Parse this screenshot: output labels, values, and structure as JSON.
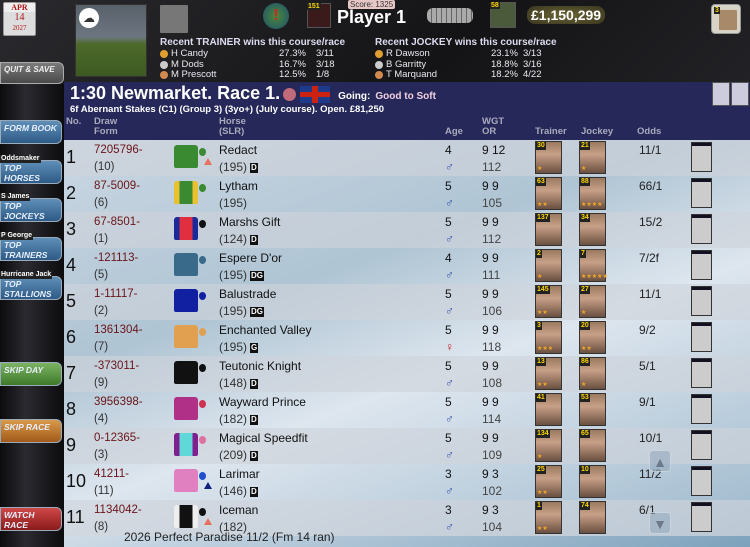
{
  "date": {
    "month": "APR",
    "day": "14",
    "year": "2027"
  },
  "top": {
    "score": "Score: 1325",
    "player": "Player 1",
    "money": "£1,150,299",
    "silhouette_count": "151",
    "stable_count": "58",
    "book_count": "3"
  },
  "recent_trainer": {
    "header": "Recent TRAINER wins this course/race",
    "rows": [
      {
        "name": "H Candy",
        "pct": "27.3%",
        "ratio": "3/11"
      },
      {
        "name": "M Dods",
        "pct": "16.7%",
        "ratio": "3/18"
      },
      {
        "name": "M Prescott",
        "pct": "12.5%",
        "ratio": "1/8"
      }
    ]
  },
  "recent_jockey": {
    "header": "Recent JOCKEY wins this course/race",
    "rows": [
      {
        "name": "R Dawson",
        "pct": "23.1%",
        "ratio": "3/13"
      },
      {
        "name": "B Garritty",
        "pct": "18.8%",
        "ratio": "3/16"
      },
      {
        "name": "T Marquand",
        "pct": "18.2%",
        "ratio": "4/22"
      }
    ]
  },
  "left": {
    "quit": "QUIT & SAVE",
    "form_book": "FORM BOOK",
    "top_horses_tag": "Oddsmaker",
    "top_horses": "TOP HORSES",
    "top_jockeys_tag": "S James",
    "top_jockeys": "TOP JOCKEYS",
    "top_trainers_tag": "P George",
    "top_trainers": "TOP TRAINERS",
    "top_stallions_tag": "Hurricane Jack",
    "top_stallions": "TOP STALLIONS",
    "skip_day": "SKIP DAY",
    "skip_race": "SKIP RACE",
    "watch_race": "WATCH RACE"
  },
  "race": {
    "title": "1:30 Newmarket. Race 1.",
    "going_label": "Going:",
    "going": "Good to Soft",
    "subtitle": "6f Abernant Stakes (C1) (Group 3) (3yo+) (July course). Open. £81,250"
  },
  "columns": {
    "no": "No.",
    "draw": "Draw",
    "form": "Form",
    "horse": "Horse",
    "slr": "(SLR)",
    "age": "Age",
    "wgt": "WGT",
    "or": "OR",
    "trainer": "Trainer",
    "jockey": "Jockey",
    "odds": "Odds"
  },
  "runners": [
    {
      "no": "1",
      "form": "7205796-",
      "draw": "(10)",
      "name": "Redact",
      "slr": "(195)",
      "badge": "D",
      "age": "4",
      "sex": "♂",
      "wgt": "9 12",
      "or": "112",
      "trainer_num": "30",
      "trainer_stars": "★",
      "jockey_num": "21",
      "jockey_stars": "★",
      "odds": "11/1"
    },
    {
      "no": "2",
      "form": "87-5009-",
      "draw": "(6)",
      "name": "Lytham",
      "slr": "(195)",
      "badge": "",
      "age": "5",
      "sex": "♂",
      "wgt": "9 9",
      "or": "105",
      "trainer_num": "63",
      "trainer_stars": "★★",
      "jockey_num": "88",
      "jockey_stars": "★★★★",
      "odds": "66/1"
    },
    {
      "no": "3",
      "form": "67-8501-",
      "draw": "(1)",
      "name": "Marshs Gift",
      "slr": "(124)",
      "badge": "D",
      "age": "5",
      "sex": "♂",
      "wgt": "9 9",
      "or": "112",
      "trainer_num": "137",
      "trainer_stars": "",
      "jockey_num": "34",
      "jockey_stars": "",
      "odds": "15/2"
    },
    {
      "no": "4",
      "form": "-121113-",
      "draw": "(5)",
      "name": "Espere D'or",
      "slr": "(195)",
      "badge": "DG",
      "age": "4",
      "sex": "♂",
      "wgt": "9 9",
      "or": "111",
      "trainer_num": "2",
      "trainer_stars": "★",
      "jockey_num": "7",
      "jockey_stars": "★★★★★",
      "odds": "7/2f"
    },
    {
      "no": "5",
      "form": "1-11117-",
      "draw": "(2)",
      "name": "Balustrade",
      "slr": "(195)",
      "badge": "DG",
      "age": "5",
      "sex": "♂",
      "wgt": "9 9",
      "or": "106",
      "trainer_num": "145",
      "trainer_stars": "★★",
      "jockey_num": "27",
      "jockey_stars": "★",
      "odds": "11/1"
    },
    {
      "no": "6",
      "form": "1361304-",
      "draw": "(7)",
      "name": "Enchanted Valley",
      "slr": "(195)",
      "badge": "G",
      "age": "5",
      "sex": "♀",
      "wgt": "9 9",
      "or": "118",
      "trainer_num": "3",
      "trainer_stars": "★★★",
      "jockey_num": "20",
      "jockey_stars": "★★",
      "odds": "9/2"
    },
    {
      "no": "7",
      "form": "-373011-",
      "draw": "(9)",
      "name": "Teutonic Knight",
      "slr": "(148)",
      "badge": "D",
      "age": "5",
      "sex": "♂",
      "wgt": "9 9",
      "or": "108",
      "trainer_num": "13",
      "trainer_stars": "★★",
      "jockey_num": "86",
      "jockey_stars": "★",
      "odds": "5/1"
    },
    {
      "no": "8",
      "form": "3956398-",
      "draw": "(4)",
      "name": "Wayward Prince",
      "slr": "(182)",
      "badge": "D",
      "age": "5",
      "sex": "♂",
      "wgt": "9 9",
      "or": "114",
      "trainer_num": "41",
      "trainer_stars": "",
      "jockey_num": "53",
      "jockey_stars": "",
      "odds": "9/1"
    },
    {
      "no": "9",
      "form": "0-12365-",
      "draw": "(3)",
      "name": "Magical Speedfit",
      "slr": "(209)",
      "badge": "D",
      "age": "5",
      "sex": "♂",
      "wgt": "9 9",
      "or": "109",
      "trainer_num": "134",
      "trainer_stars": "★",
      "jockey_num": "65",
      "jockey_stars": "",
      "odds": "10/1"
    },
    {
      "no": "10",
      "form": "41211-",
      "draw": "(11)",
      "name": "Larimar",
      "slr": "(146)",
      "badge": "D",
      "age": "3",
      "sex": "♂",
      "wgt": "9 3",
      "or": "102",
      "trainer_num": "25",
      "trainer_stars": "★★",
      "jockey_num": "10",
      "jockey_stars": "",
      "odds": "11/2"
    },
    {
      "no": "11",
      "form": "1134042-",
      "draw": "(8)",
      "name": "Iceman",
      "slr": "(182)",
      "badge": "",
      "age": "3",
      "sex": "♂",
      "wgt": "9 3",
      "or": "104",
      "trainer_num": "1",
      "trainer_stars": "★★",
      "jockey_num": "74",
      "jockey_stars": "",
      "odds": "6/1"
    }
  ],
  "silks": [
    {
      "body": "#3a8a32",
      "sleeve": "#3a8a32",
      "cap": "#3a8a32",
      "tri": "#e87060"
    },
    {
      "body": "#3a8a32",
      "sleeve": "#e8c030",
      "cap": "#3a8a32",
      "tri": ""
    },
    {
      "body": "#e03040",
      "sleeve": "#1a2a9a",
      "cap": "#111",
      "tri": ""
    },
    {
      "body": "#3a6a8a",
      "sleeve": "#3a6a8a",
      "cap": "#3a6a8a",
      "tri": ""
    },
    {
      "body": "#1020a0",
      "sleeve": "#1020a0",
      "cap": "#1020a0",
      "tri": ""
    },
    {
      "body": "#e0a050",
      "sleeve": "#e0a050",
      "cap": "#e0a050",
      "tri": ""
    },
    {
      "body": "#111",
      "sleeve": "#111",
      "cap": "#111",
      "tri": ""
    },
    {
      "body": "#b03088",
      "sleeve": "#b03088",
      "cap": "#d03050",
      "tri": ""
    },
    {
      "body": "#60d8d8",
      "sleeve": "#802090",
      "cap": "#e070a0",
      "tri": ""
    },
    {
      "body": "#e080c0",
      "sleeve": "#e080c0",
      "cap": "#2050d0",
      "tri": "#102080"
    },
    {
      "body": "#111",
      "sleeve": "#eee",
      "cap": "#111",
      "tri": "#e87060"
    }
  ],
  "footer": "2026  Perfect Paradise  11/2  (Fm 14 ran)"
}
